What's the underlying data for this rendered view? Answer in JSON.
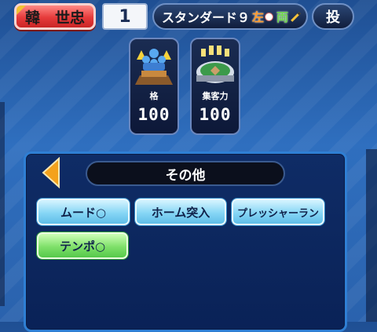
{
  "player": {
    "name": "韓　世忠",
    "number": "1"
  },
  "title": {
    "text": "スタンダード９",
    "throw_hand": "左",
    "bat_hand": "両"
  },
  "position": "投",
  "stats": [
    {
      "label": "格",
      "value": "100"
    },
    {
      "label": "集客力",
      "value": "100"
    }
  ],
  "ability_panel": {
    "header": "その他",
    "abilities": [
      {
        "label": "ムード○",
        "style": "blue"
      },
      {
        "label": "ホーム突入",
        "style": "blue"
      },
      {
        "label": "プレッシャーラン",
        "style": "blue"
      },
      {
        "label": "テンポ○",
        "style": "green"
      }
    ]
  },
  "icons": {
    "kaku": "ranking-podium-icon",
    "crowd": "stadium-icon",
    "back": "back-arrow-icon"
  },
  "colors": {
    "name_plate": "#e63b3b",
    "ability_blue": "#86d6f5",
    "ability_green": "#7fe06a",
    "panel_border": "#2f7fd4"
  }
}
